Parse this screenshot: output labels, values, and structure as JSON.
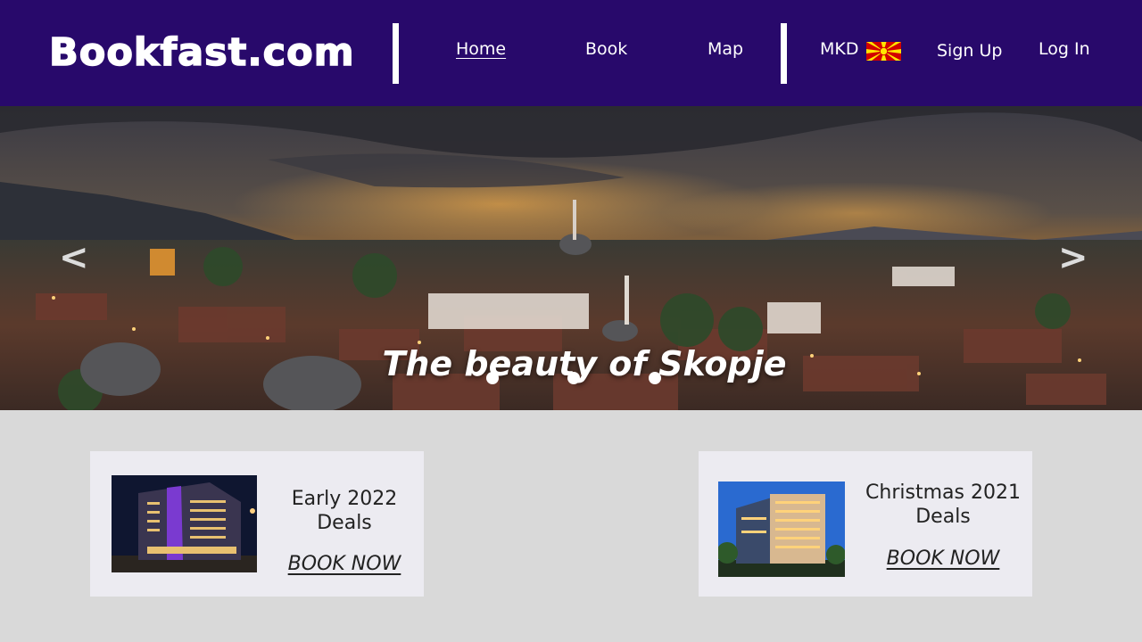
{
  "header": {
    "logo": "Bookfast.com",
    "nav": {
      "home": "Home",
      "book": "Book",
      "map": "Map",
      "currency": "MKD",
      "signup": "Sign Up",
      "login": "Log In"
    },
    "colors": {
      "background": "#28096b",
      "text": "#ffffff"
    }
  },
  "hero": {
    "caption": "The beauty of Skopje",
    "prev_symbol": "<",
    "next_symbol": ">",
    "slide_count": 3
  },
  "deals": [
    {
      "title_line1": "Early 2022",
      "title_line2": "Deals",
      "cta": "BOOK NOW"
    },
    {
      "title_line1": "Christmas 2021",
      "title_line2": "Deals",
      "cta": "BOOK NOW"
    }
  ]
}
